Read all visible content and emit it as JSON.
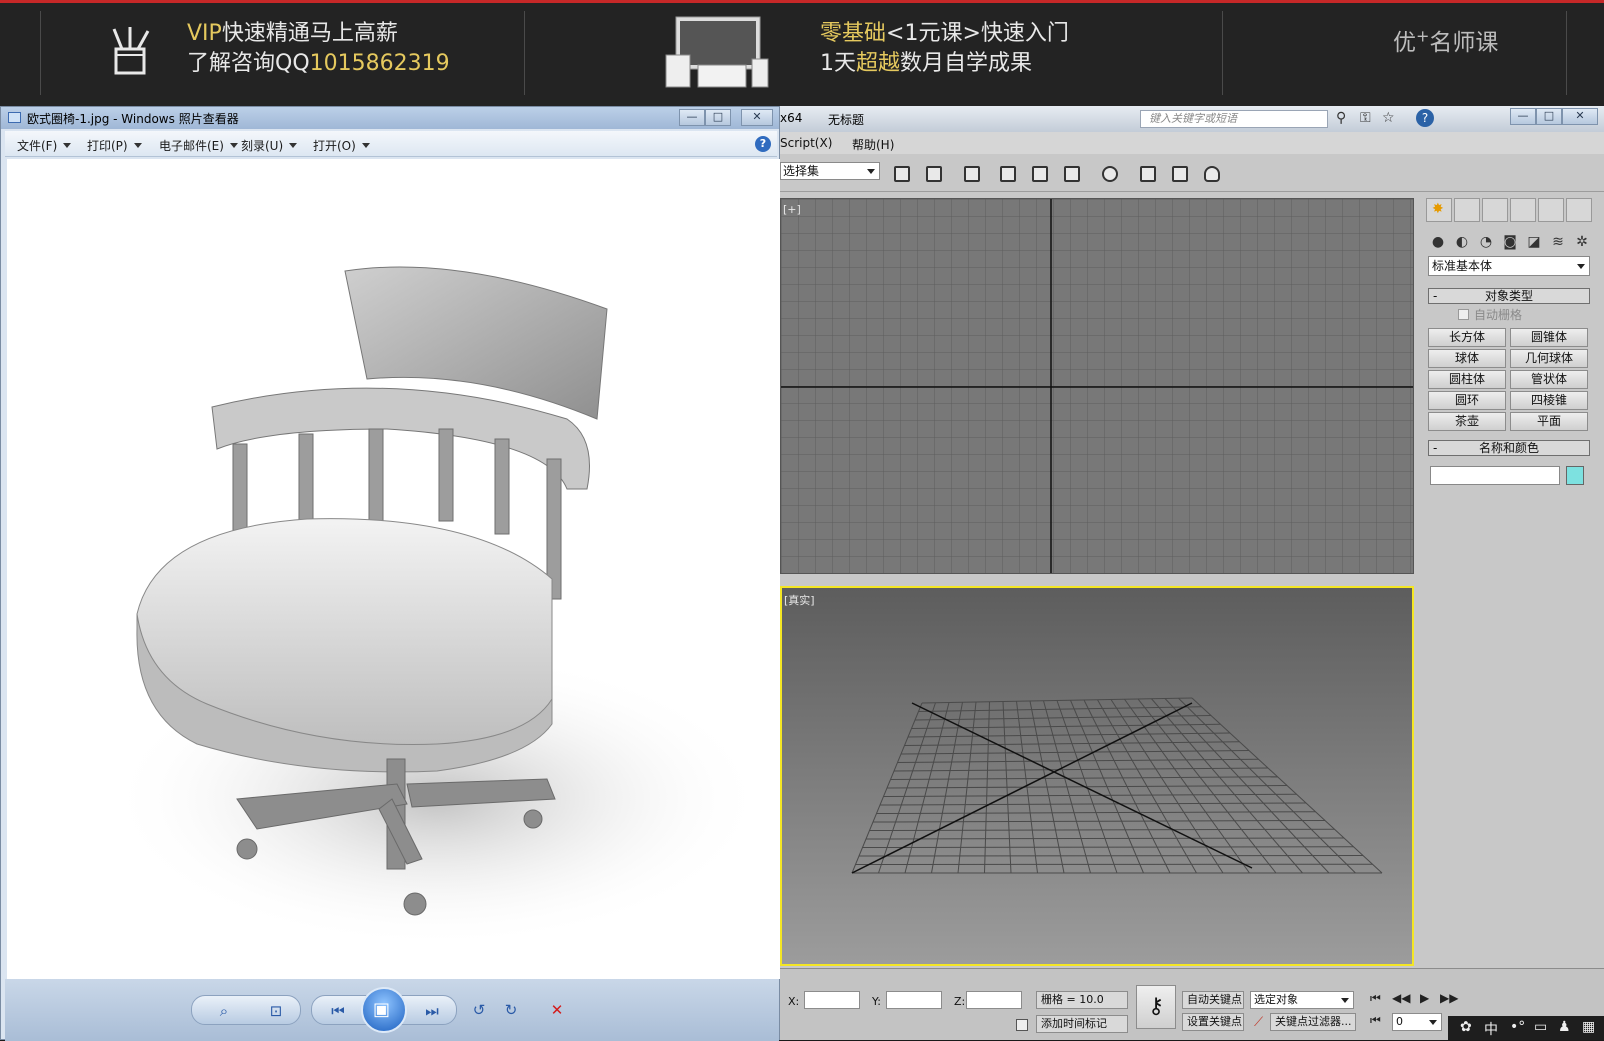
{
  "banner": {
    "line1_vip": "VIP",
    "line1_rest": "快速精通马上高薪",
    "line2_pre": "了解咨询QQ",
    "line2_qq": "1015862319",
    "line3_hl": "零基础",
    "line3_rest": "<1元课>快速入门",
    "line4_pre": "1天",
    "line4_hl": "超越",
    "line4_rest": "数月自学成果",
    "brand_a": "优",
    "brand_sup": "+",
    "brand_b": "名师课",
    "accent": "#e5c95e"
  },
  "photo_viewer": {
    "title": "欧式圈椅-1.jpg - Windows 照片查看器",
    "min": "—",
    "max": "□",
    "close": "✕",
    "menu": [
      "文件(F)",
      "打印(P)",
      "电子邮件(E)",
      "刻录(U)",
      "打开(O)"
    ],
    "help": "?",
    "controls": {
      "zoom": "⌕",
      "fit": "⊡",
      "prev": "⏮",
      "slideshow": "▣",
      "next": "⏭",
      "rotate_ccw": "↺",
      "rotate_cw": "↻",
      "delete": "✕"
    }
  },
  "max": {
    "title_left": "x64",
    "title_doc": "无标题",
    "search_placeholder": "键入关键字或短语",
    "menu": [
      "Script(X)",
      "帮助(H)"
    ],
    "selection_set": "选择集",
    "vp_top_label": "[+]",
    "vp_persp_label": "[真实]",
    "command_panel": {
      "dropdown": "标准基本体",
      "rollout1": "对象类型",
      "rollout_toggle": "-",
      "autogrid": "自动栅格",
      "buttons": [
        "长方体",
        "圆锥体",
        "球体",
        "几何球体",
        "圆柱体",
        "管状体",
        "圆环",
        "四棱锥",
        "茶壶",
        "平面"
      ],
      "rollout2": "名称和颜色",
      "object_color": "#7de1e0"
    },
    "status": {
      "x": "X:",
      "y": "Y:",
      "z": "Z:",
      "grid": "栅格 = 10.0",
      "add_time_tag": "添加时间标记",
      "auto_key": "自动关键点",
      "set_key": "设置关键点",
      "selected": "选定对象",
      "key_filters": "关键点过滤器...",
      "frame": "0"
    }
  },
  "tray": {
    "ime": "中"
  }
}
